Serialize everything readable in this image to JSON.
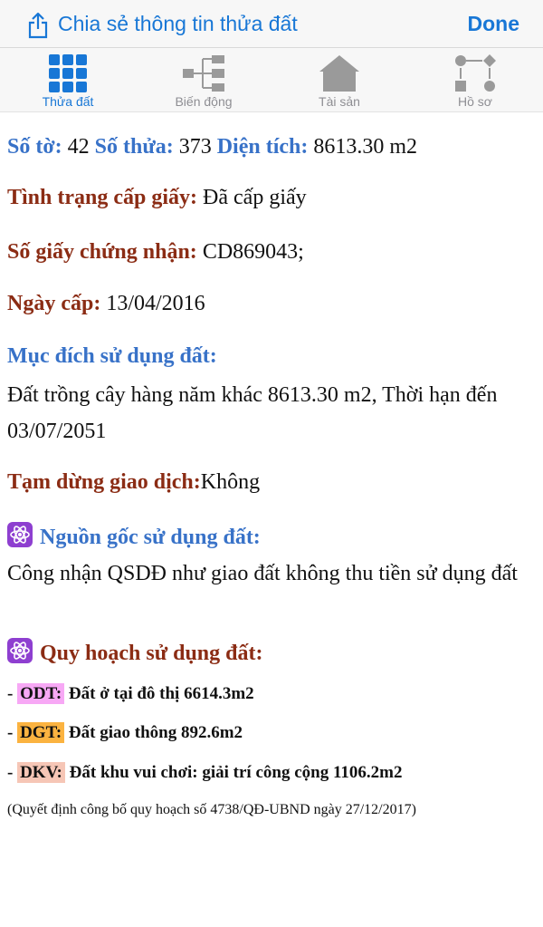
{
  "header": {
    "title": "Chia sẻ thông tin thửa đất",
    "done_label": "Done",
    "share_icon": "share-icon",
    "accent": "#1877d6"
  },
  "tabs": [
    {
      "label": "Thửa đất",
      "icon": "grid-icon",
      "active": true
    },
    {
      "label": "Biến động",
      "icon": "tree-diagram-icon",
      "active": false
    },
    {
      "label": "Tài sản",
      "icon": "house-icon",
      "active": false
    },
    {
      "label": "Hồ sơ",
      "icon": "flowchart-icon",
      "active": false
    }
  ],
  "parcel": {
    "sheet_label": "Số tờ:",
    "sheet_value": "42",
    "plot_label": "Số thửa:",
    "plot_value": "373",
    "area_label": "Diện tích:",
    "area_value": "8613.30 m2",
    "cert_status_label": "Tình trạng cấp giấy:",
    "cert_status_value": "Đã cấp giấy",
    "cert_no_label": "Số giấy chứng nhận:",
    "cert_no_value": "CD869043;",
    "issue_date_label": "Ngày cấp:",
    "issue_date_value": "13/04/2016",
    "purpose_label": "Mục đích sử dụng đất:",
    "purpose_value": "Đất trồng cây hàng năm khác 8613.30 m2, Thời hạn đến 03/07/2051",
    "suspend_label": "Tạm dừng giao dịch:",
    "suspend_value": "Không",
    "origin_label": "Nguồn gốc sử dụng đất:",
    "origin_value": "Công nhận QSDĐ như giao đất không thu tiền sử dụng đất",
    "planning_label": "Quy hoạch sử dụng đất:",
    "planning_items": [
      {
        "code": "ODT:",
        "desc": "Đất ở tại đô thị 6614.3m2",
        "color": "#f7a8f5"
      },
      {
        "code": "DGT:",
        "desc": "Đất giao thông 892.6m2",
        "color": "#fbb340"
      },
      {
        "code": "DKV:",
        "desc": "Đất khu vui chơi: giải trí công cộng 1106.2m2",
        "color": "#f6c6b6"
      }
    ],
    "planning_note": "(Quyết định công bố quy hoạch số 4738/QĐ-UBND ngày 27/12/2017)"
  }
}
